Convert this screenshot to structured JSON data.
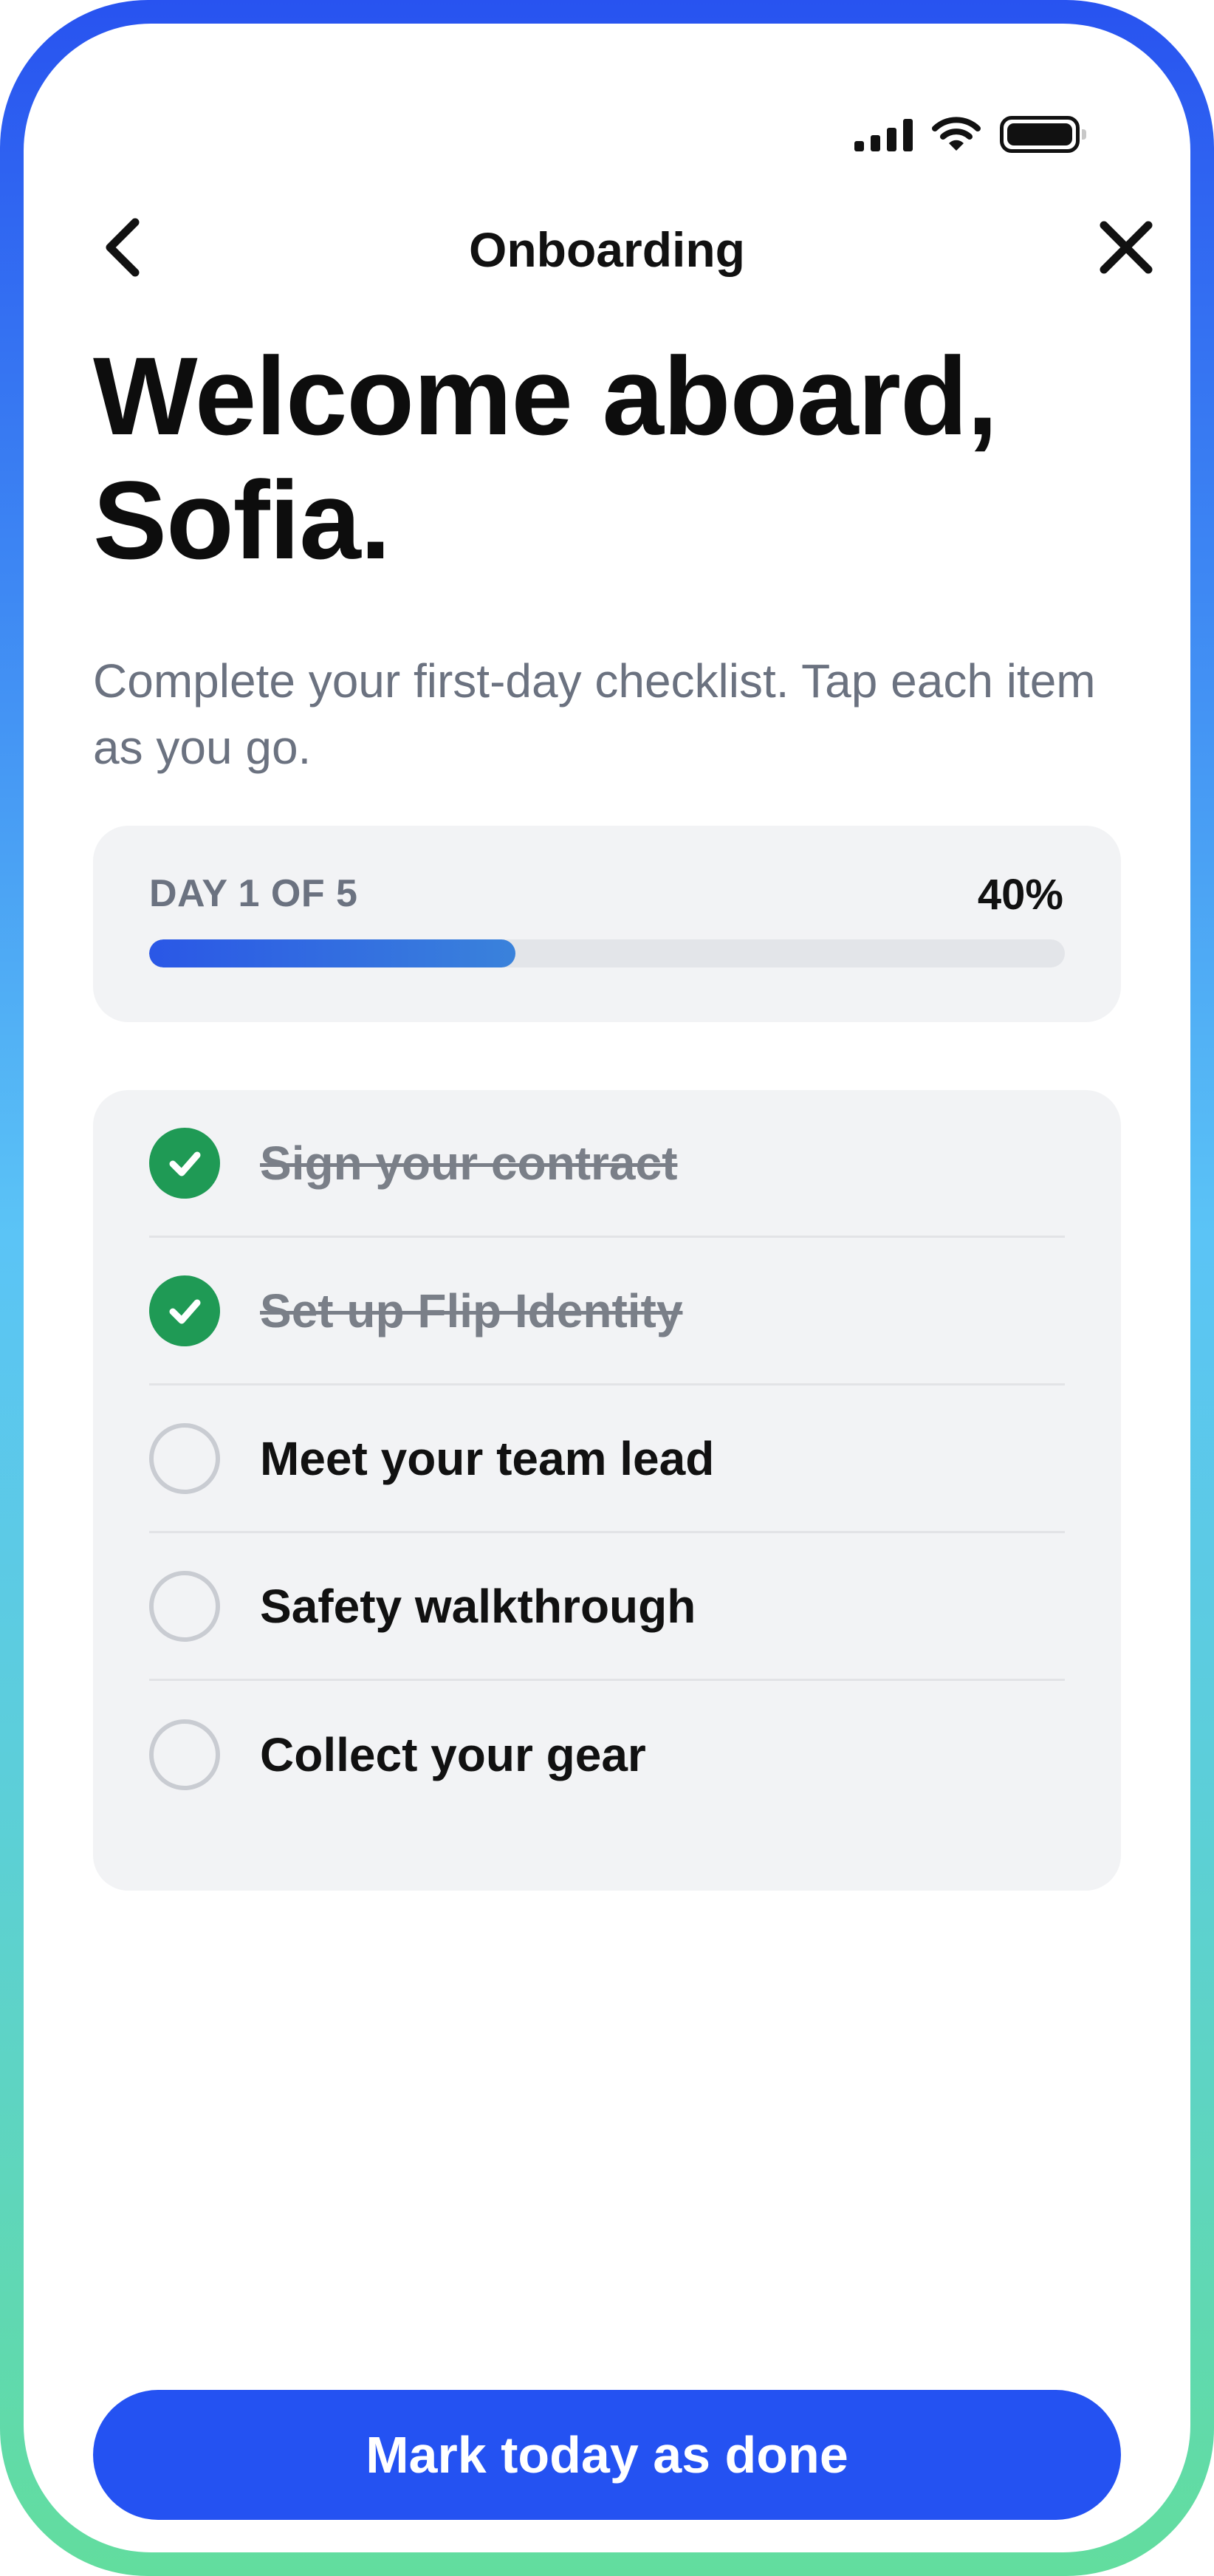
{
  "colors": {
    "accent": "#2452f2",
    "success": "#1f9a55",
    "frame_gradient_top": "#2853f0",
    "frame_gradient_bottom": "#62dd9e"
  },
  "status_bar": {
    "icons": [
      "cellular-signal-icon",
      "wifi-icon",
      "battery-icon"
    ]
  },
  "nav": {
    "back_icon": "chevron-left-icon",
    "title": "Onboarding",
    "close_icon": "close-icon"
  },
  "header": {
    "line1": "Welcome aboard,",
    "line2": "Sofia.",
    "subtitle": "Complete your first-day checklist. Tap each item as you go."
  },
  "progress": {
    "label": "DAY 1 OF 5",
    "percent_text": "40%",
    "percent": 40
  },
  "checklist": {
    "items": [
      {
        "label": "Sign your contract",
        "done": true
      },
      {
        "label": "Set up Flip Identity",
        "done": true
      },
      {
        "label": "Meet your team lead",
        "done": false
      },
      {
        "label": "Safety walkthrough",
        "done": false
      },
      {
        "label": "Collect your gear",
        "done": false
      }
    ]
  },
  "cta": {
    "label": "Mark today as done"
  }
}
